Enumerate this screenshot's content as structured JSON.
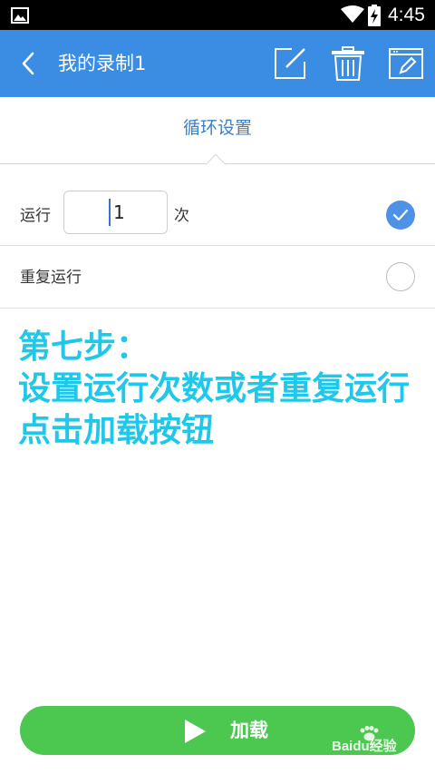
{
  "status_bar": {
    "time": "4:45",
    "icons": [
      "gallery-icon",
      "wifi-icon",
      "battery-charging-icon"
    ]
  },
  "app_bar": {
    "title": "我的录制1",
    "back_icon": "chevron-left-icon",
    "actions": [
      "edit-icon",
      "trash-icon",
      "window-edit-icon"
    ]
  },
  "section": {
    "label": "循环设置"
  },
  "run_row": {
    "label": "运行",
    "count_value": "1",
    "unit": "次",
    "selected": true
  },
  "repeat_row": {
    "label": "重复运行",
    "selected": false
  },
  "annotation": {
    "line1": "第七步：",
    "line2": "设置运行次数或者重复运行",
    "line3": "点击加载按钮"
  },
  "load_button": {
    "label": "加载",
    "icon": "play-icon"
  },
  "watermark": {
    "text": "Baidu经验",
    "url": "jingyan.baidu.com"
  },
  "colors": {
    "app_bar": "#3b8de4",
    "section_label": "#3b80c6",
    "radio_selected": "#5091e8",
    "annotation": "#1fc7e8",
    "load_button": "#4cc750"
  }
}
